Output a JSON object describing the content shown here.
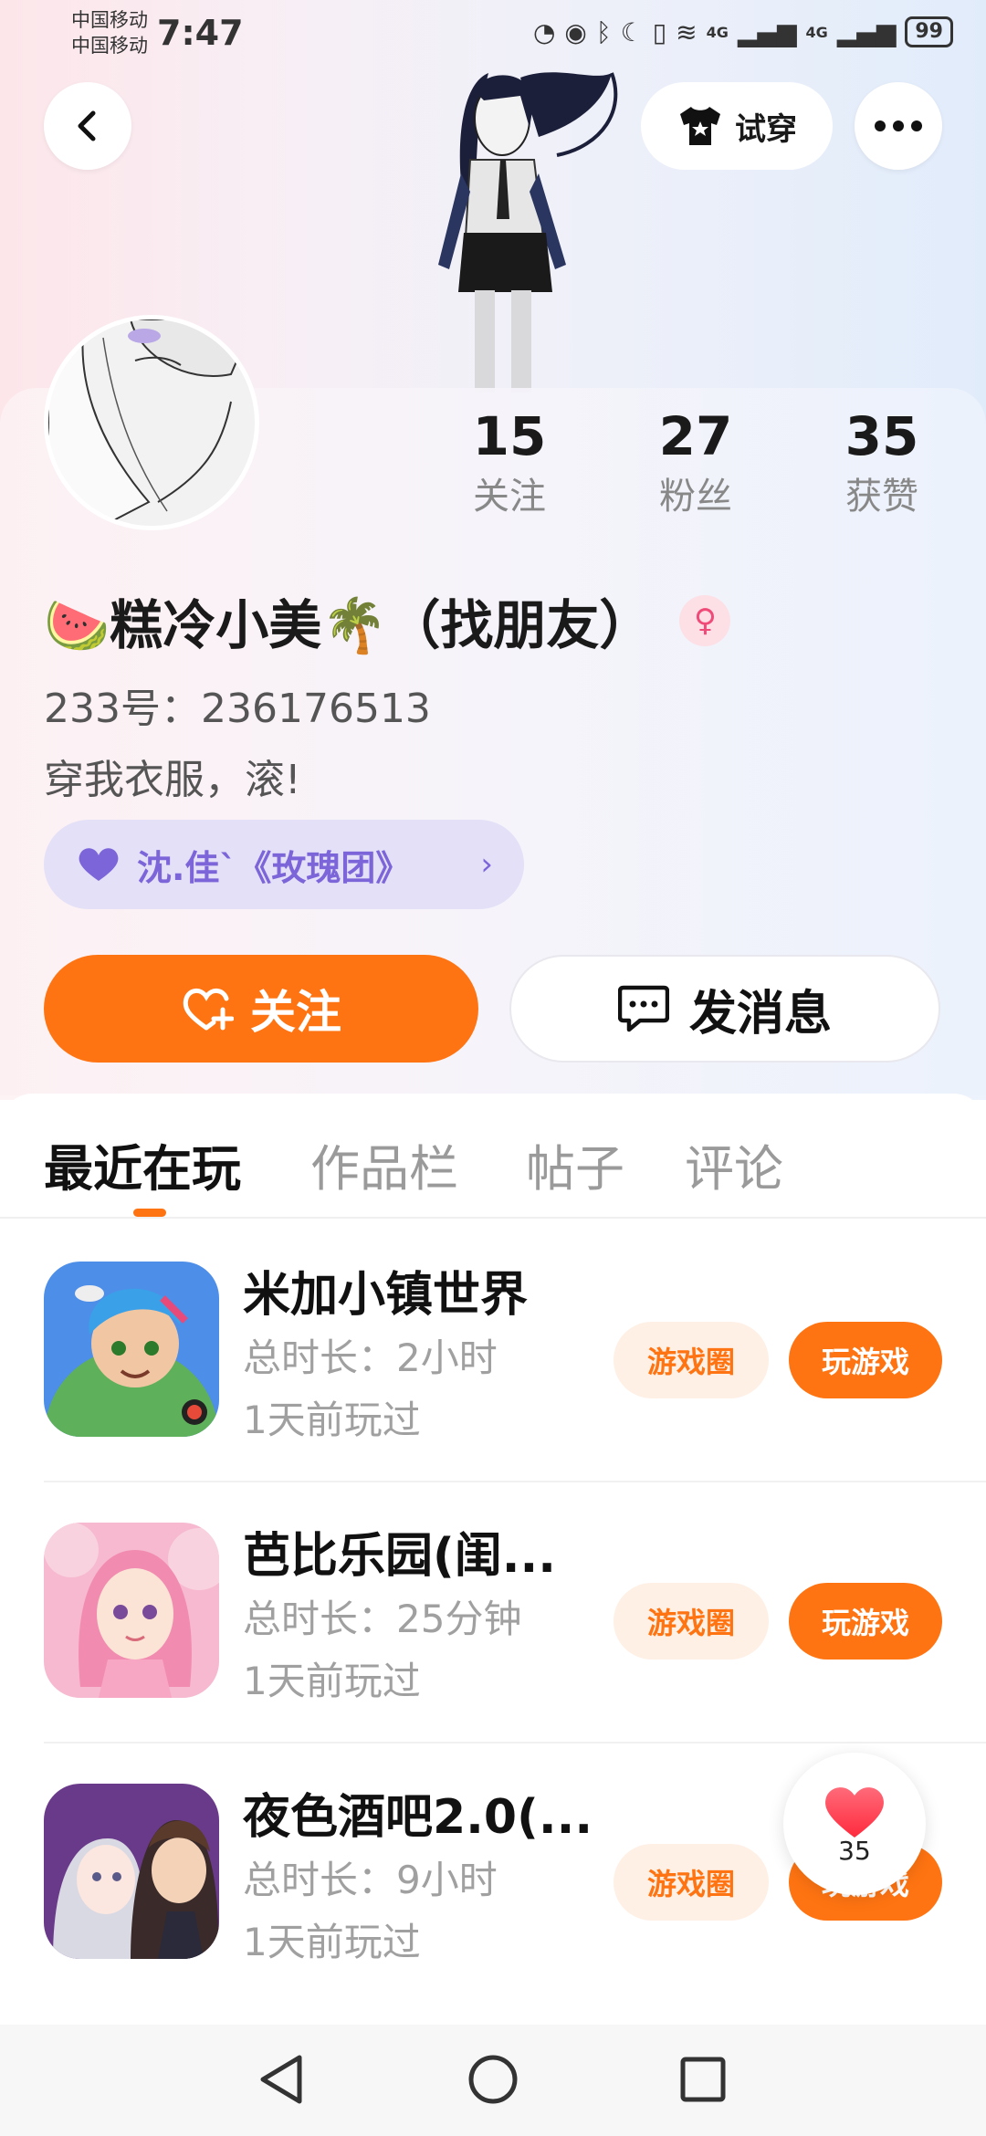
{
  "status_bar": {
    "carrier1": "中国移动",
    "carrier2": "中国移动",
    "time": "7:47",
    "network1": "4G",
    "network2": "4G",
    "battery": "99"
  },
  "header": {
    "try_on_label": "试穿"
  },
  "profile": {
    "stats": [
      {
        "value": "15",
        "label": "关注"
      },
      {
        "value": "27",
        "label": "粉丝"
      },
      {
        "value": "35",
        "label": "获赞"
      }
    ],
    "name": "🍉糕冷小美🌴（找朋友）",
    "uid": "233号：236176513",
    "bio": "穿我衣服，滚!",
    "group": "沈.佳`《玫瑰团》",
    "follow_label": "关注",
    "message_label": "发消息"
  },
  "tabs": [
    {
      "label": "最近在玩",
      "active": true
    },
    {
      "label": "作品栏",
      "active": false
    },
    {
      "label": "帖子",
      "active": false
    },
    {
      "label": "评论",
      "active": false
    }
  ],
  "games": [
    {
      "name": "米加小镇世界",
      "duration": "总时长：2小时",
      "last_played": "1天前玩过",
      "circle_label": "游戏圈",
      "play_label": "玩游戏"
    },
    {
      "name": "芭比乐园(闺...",
      "duration": "总时长：25分钟",
      "last_played": "1天前玩过",
      "circle_label": "游戏圈",
      "play_label": "玩游戏"
    },
    {
      "name": "夜色酒吧2.0(...",
      "duration": "总时长：9小时",
      "last_played": "1天前玩过",
      "circle_label": "游戏圈",
      "play_label": "玩游戏"
    }
  ],
  "like_fab": {
    "count": "35"
  },
  "colors": {
    "accent": "#ff7412",
    "group_chip": "#7c64d9",
    "gender": "#f04b78"
  }
}
